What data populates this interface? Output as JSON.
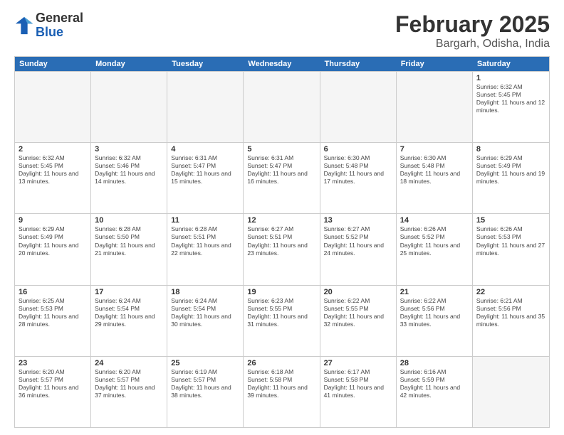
{
  "logo": {
    "general": "General",
    "blue": "Blue"
  },
  "title": "February 2025",
  "subtitle": "Bargarh, Odisha, India",
  "days_of_week": [
    "Sunday",
    "Monday",
    "Tuesday",
    "Wednesday",
    "Thursday",
    "Friday",
    "Saturday"
  ],
  "weeks": [
    [
      {
        "day": "",
        "info": "",
        "empty": true
      },
      {
        "day": "",
        "info": "",
        "empty": true
      },
      {
        "day": "",
        "info": "",
        "empty": true
      },
      {
        "day": "",
        "info": "",
        "empty": true
      },
      {
        "day": "",
        "info": "",
        "empty": true
      },
      {
        "day": "",
        "info": "",
        "empty": true
      },
      {
        "day": "1",
        "info": "Sunrise: 6:32 AM\nSunset: 5:45 PM\nDaylight: 11 hours and 12 minutes.",
        "empty": false
      }
    ],
    [
      {
        "day": "2",
        "info": "Sunrise: 6:32 AM\nSunset: 5:45 PM\nDaylight: 11 hours and 13 minutes.",
        "empty": false
      },
      {
        "day": "3",
        "info": "Sunrise: 6:32 AM\nSunset: 5:46 PM\nDaylight: 11 hours and 14 minutes.",
        "empty": false
      },
      {
        "day": "4",
        "info": "Sunrise: 6:31 AM\nSunset: 5:47 PM\nDaylight: 11 hours and 15 minutes.",
        "empty": false
      },
      {
        "day": "5",
        "info": "Sunrise: 6:31 AM\nSunset: 5:47 PM\nDaylight: 11 hours and 16 minutes.",
        "empty": false
      },
      {
        "day": "6",
        "info": "Sunrise: 6:30 AM\nSunset: 5:48 PM\nDaylight: 11 hours and 17 minutes.",
        "empty": false
      },
      {
        "day": "7",
        "info": "Sunrise: 6:30 AM\nSunset: 5:48 PM\nDaylight: 11 hours and 18 minutes.",
        "empty": false
      },
      {
        "day": "8",
        "info": "Sunrise: 6:29 AM\nSunset: 5:49 PM\nDaylight: 11 hours and 19 minutes.",
        "empty": false
      }
    ],
    [
      {
        "day": "9",
        "info": "Sunrise: 6:29 AM\nSunset: 5:49 PM\nDaylight: 11 hours and 20 minutes.",
        "empty": false
      },
      {
        "day": "10",
        "info": "Sunrise: 6:28 AM\nSunset: 5:50 PM\nDaylight: 11 hours and 21 minutes.",
        "empty": false
      },
      {
        "day": "11",
        "info": "Sunrise: 6:28 AM\nSunset: 5:51 PM\nDaylight: 11 hours and 22 minutes.",
        "empty": false
      },
      {
        "day": "12",
        "info": "Sunrise: 6:27 AM\nSunset: 5:51 PM\nDaylight: 11 hours and 23 minutes.",
        "empty": false
      },
      {
        "day": "13",
        "info": "Sunrise: 6:27 AM\nSunset: 5:52 PM\nDaylight: 11 hours and 24 minutes.",
        "empty": false
      },
      {
        "day": "14",
        "info": "Sunrise: 6:26 AM\nSunset: 5:52 PM\nDaylight: 11 hours and 25 minutes.",
        "empty": false
      },
      {
        "day": "15",
        "info": "Sunrise: 6:26 AM\nSunset: 5:53 PM\nDaylight: 11 hours and 27 minutes.",
        "empty": false
      }
    ],
    [
      {
        "day": "16",
        "info": "Sunrise: 6:25 AM\nSunset: 5:53 PM\nDaylight: 11 hours and 28 minutes.",
        "empty": false
      },
      {
        "day": "17",
        "info": "Sunrise: 6:24 AM\nSunset: 5:54 PM\nDaylight: 11 hours and 29 minutes.",
        "empty": false
      },
      {
        "day": "18",
        "info": "Sunrise: 6:24 AM\nSunset: 5:54 PM\nDaylight: 11 hours and 30 minutes.",
        "empty": false
      },
      {
        "day": "19",
        "info": "Sunrise: 6:23 AM\nSunset: 5:55 PM\nDaylight: 11 hours and 31 minutes.",
        "empty": false
      },
      {
        "day": "20",
        "info": "Sunrise: 6:22 AM\nSunset: 5:55 PM\nDaylight: 11 hours and 32 minutes.",
        "empty": false
      },
      {
        "day": "21",
        "info": "Sunrise: 6:22 AM\nSunset: 5:56 PM\nDaylight: 11 hours and 33 minutes.",
        "empty": false
      },
      {
        "day": "22",
        "info": "Sunrise: 6:21 AM\nSunset: 5:56 PM\nDaylight: 11 hours and 35 minutes.",
        "empty": false
      }
    ],
    [
      {
        "day": "23",
        "info": "Sunrise: 6:20 AM\nSunset: 5:57 PM\nDaylight: 11 hours and 36 minutes.",
        "empty": false
      },
      {
        "day": "24",
        "info": "Sunrise: 6:20 AM\nSunset: 5:57 PM\nDaylight: 11 hours and 37 minutes.",
        "empty": false
      },
      {
        "day": "25",
        "info": "Sunrise: 6:19 AM\nSunset: 5:57 PM\nDaylight: 11 hours and 38 minutes.",
        "empty": false
      },
      {
        "day": "26",
        "info": "Sunrise: 6:18 AM\nSunset: 5:58 PM\nDaylight: 11 hours and 39 minutes.",
        "empty": false
      },
      {
        "day": "27",
        "info": "Sunrise: 6:17 AM\nSunset: 5:58 PM\nDaylight: 11 hours and 41 minutes.",
        "empty": false
      },
      {
        "day": "28",
        "info": "Sunrise: 6:16 AM\nSunset: 5:59 PM\nDaylight: 11 hours and 42 minutes.",
        "empty": false
      },
      {
        "day": "",
        "info": "",
        "empty": true
      }
    ]
  ]
}
